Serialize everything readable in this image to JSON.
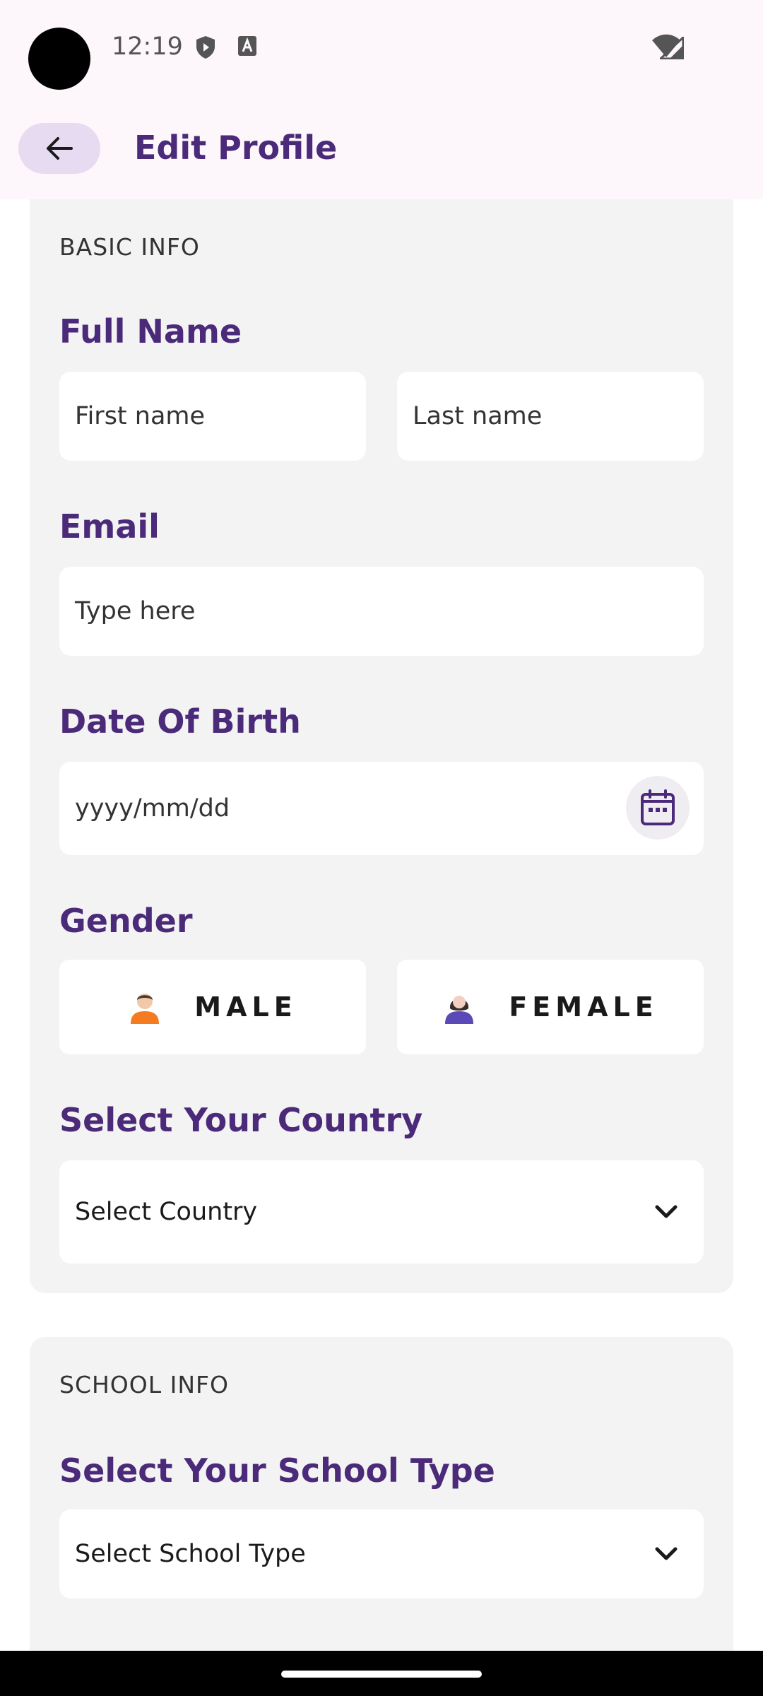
{
  "status_bar": {
    "time": "12:19"
  },
  "app_bar": {
    "title": "Edit Profile"
  },
  "basic_info": {
    "section_title": "BASIC INFO",
    "full_name_label": "Full Name",
    "first_name_placeholder": "First name",
    "last_name_placeholder": "Last name",
    "email_label": "Email",
    "email_placeholder": "Type here",
    "dob_label": "Date Of Birth",
    "dob_placeholder": "yyyy/mm/dd",
    "gender_label": "Gender",
    "gender_male": "MALE",
    "gender_female": "FEMALE",
    "country_label": "Select Your Country",
    "country_value": "Select Country"
  },
  "school_info": {
    "section_title": "SCHOOL INFO",
    "school_type_label": "Select Your School Type",
    "school_type_value": "Select School Type"
  },
  "icons": {
    "back": "arrow-left-icon",
    "calendar": "calendar-icon",
    "dropdown": "chevron-down-icon",
    "male": "male-avatar-icon",
    "female": "female-avatar-icon"
  },
  "colors": {
    "accent": "#4b2a7a",
    "back_button_bg": "#e6dbf1",
    "card_bg": "#f3f3f3",
    "header_bg": "#fdf7fb"
  }
}
